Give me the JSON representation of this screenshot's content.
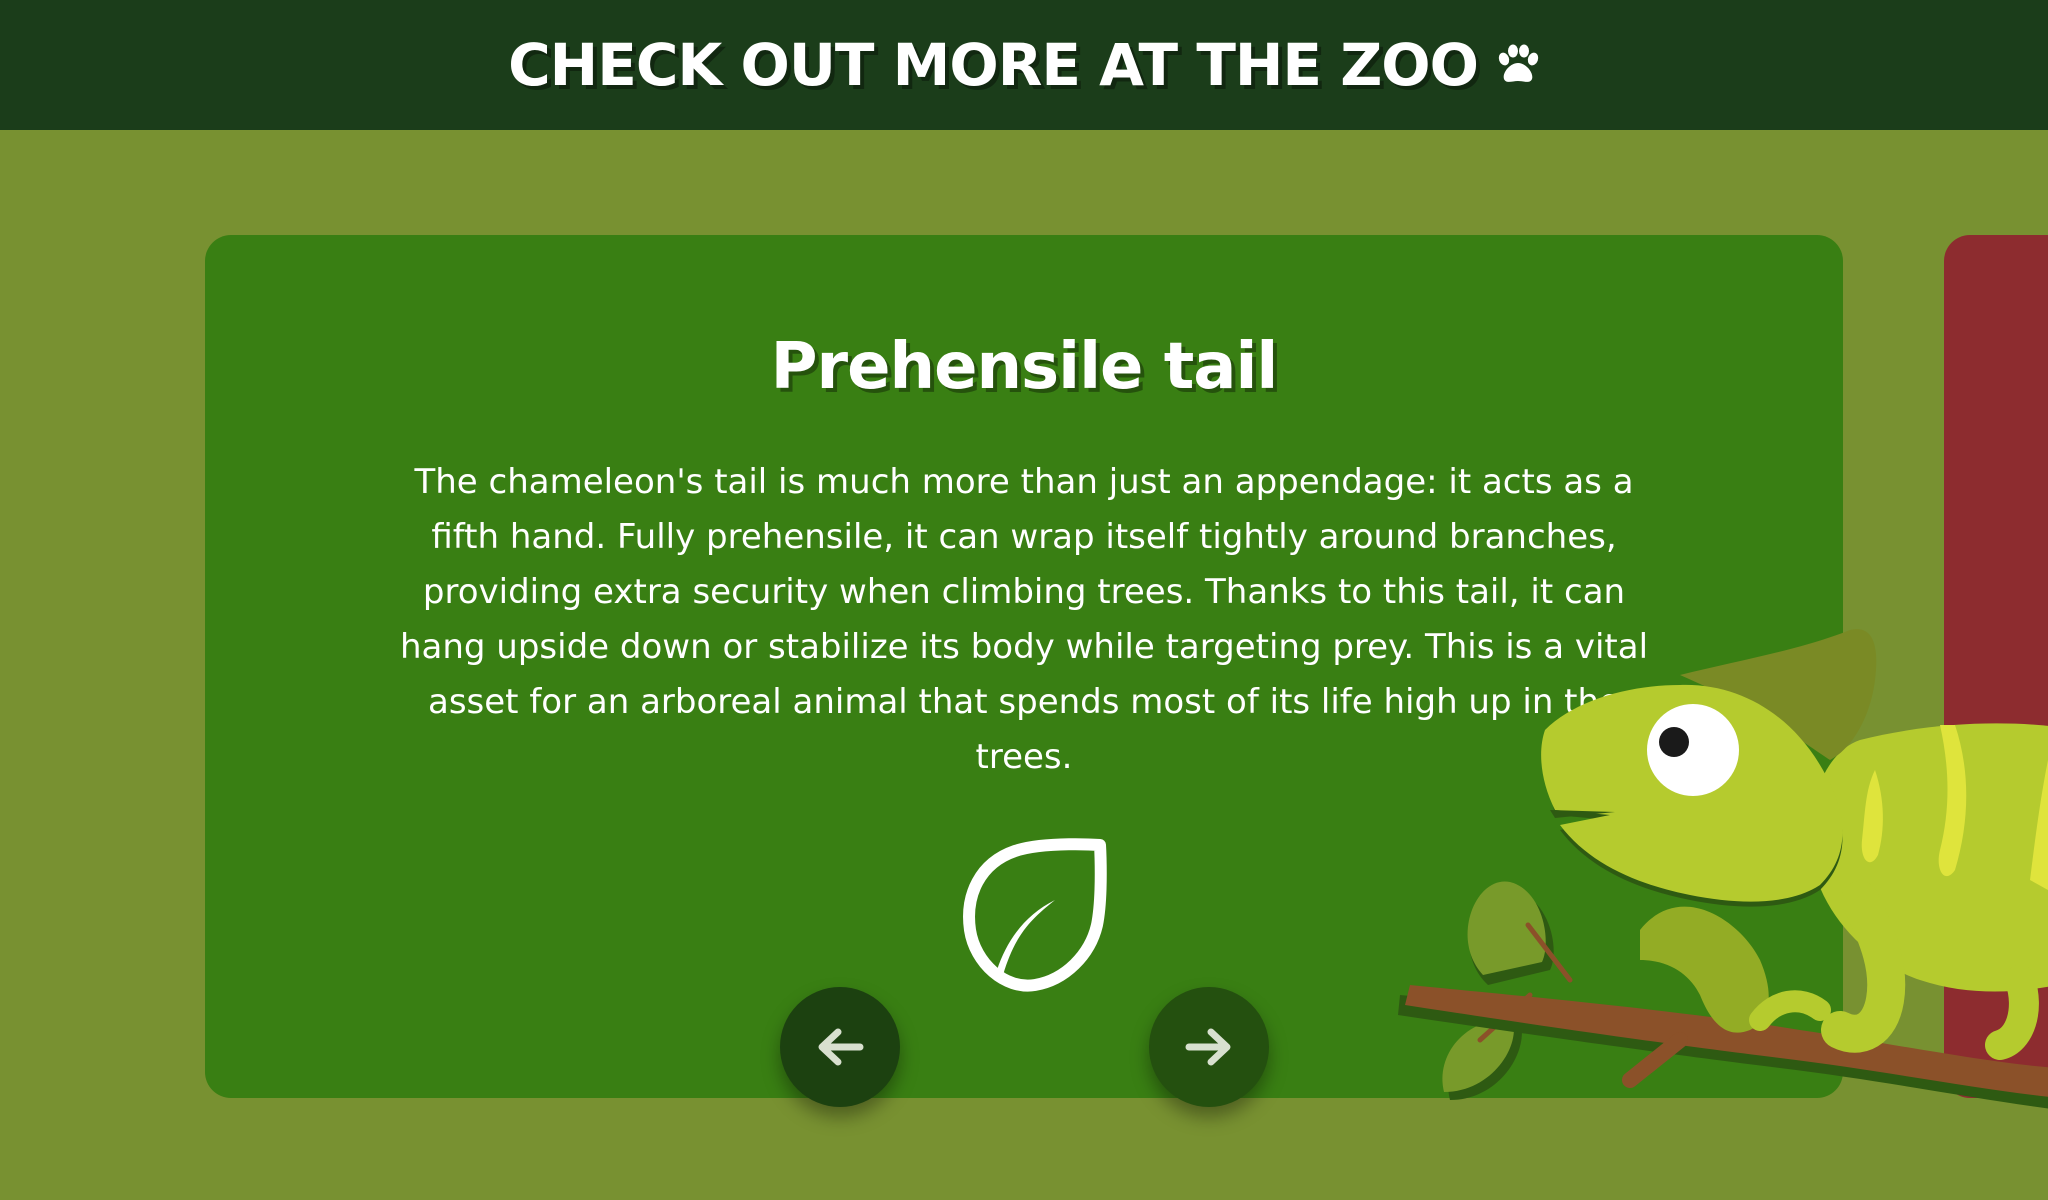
{
  "header": {
    "title": "CHECK OUT MORE AT THE ZOO",
    "icon": "paw-icon"
  },
  "slide": {
    "title": "Prehensile tail",
    "text": "The chameleon's tail is much more than just an appendage: it acts as a fifth hand. Fully prehensile, it can wrap itself tightly around branches, providing extra security when climbing trees. Thanks to this tail, it can hang upside down or stabilize its body while targeting prey. This is a vital asset for an arboreal animal that spends most of its life high up in the trees.",
    "icon": "leaf-icon"
  },
  "navigation": {
    "prev_icon": "arrow-left-icon",
    "next_icon": "arrow-right-icon"
  },
  "colors": {
    "background": "#789131",
    "header": "#1b3d1a",
    "card": "#397f13",
    "next_card": "#8d2c2f",
    "nav_button": "#1c4110",
    "chameleon": "#b5cb2e"
  }
}
